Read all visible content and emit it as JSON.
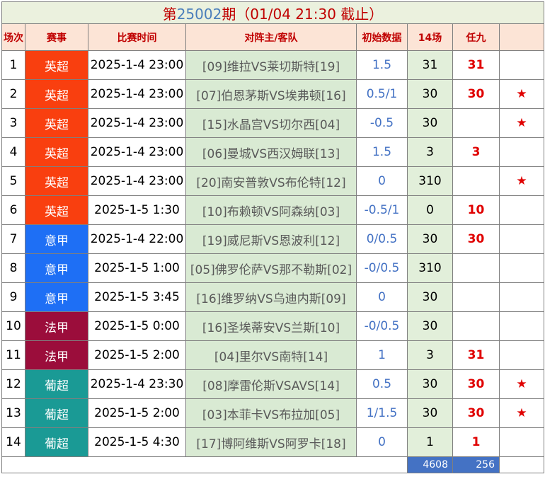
{
  "title": {
    "prefix": "第",
    "issue": "25002",
    "suffix": "期（01/04 21:30 截止）"
  },
  "headers": [
    "场次",
    "赛事",
    "比赛时间",
    "对阵主/客队",
    "初始数据",
    "14场",
    "任九",
    ""
  ],
  "league_colors": {
    "英超": "#f93f0f",
    "意甲": "#1e6ff5",
    "法甲": "#9b0d3b",
    "葡超": "#1a9a95"
  },
  "rows": [
    {
      "no": "1",
      "league": "英超",
      "time": "2025-1-4 23:00",
      "match": "[09]维拉VS莱切斯特[19]",
      "init": "1.5",
      "p14": "31",
      "r9": "31",
      "star": ""
    },
    {
      "no": "2",
      "league": "英超",
      "time": "2025-1-4 23:00",
      "match": "[07]伯恩茅斯VS埃弗顿[16]",
      "init": "0.5/1",
      "p14": "30",
      "r9": "30",
      "star": "★"
    },
    {
      "no": "3",
      "league": "英超",
      "time": "2025-1-4 23:00",
      "match": "[15]水晶宫VS切尔西[04]",
      "init": "-0.5",
      "p14": "30",
      "r9": "",
      "star": "★"
    },
    {
      "no": "4",
      "league": "英超",
      "time": "2025-1-4 23:00",
      "match": "[06]曼城VS西汉姆联[13]",
      "init": "1.5",
      "p14": "3",
      "r9": "3",
      "star": ""
    },
    {
      "no": "5",
      "league": "英超",
      "time": "2025-1-4 23:00",
      "match": "[20]南安普敦VS布伦特[12]",
      "init": "0",
      "p14": "310",
      "r9": "",
      "star": "★"
    },
    {
      "no": "6",
      "league": "英超",
      "time": "2025-1-5 1:30",
      "match": "[10]布赖顿VS阿森纳[03]",
      "init": "-0.5/1",
      "p14": "0",
      "r9": "10",
      "star": ""
    },
    {
      "no": "7",
      "league": "意甲",
      "time": "2025-1-4 22:00",
      "match": "[19]威尼斯VS恩波利[12]",
      "init": "0/0.5",
      "p14": "30",
      "r9": "30",
      "star": ""
    },
    {
      "no": "8",
      "league": "意甲",
      "time": "2025-1-5 1:00",
      "match": "[05]佛罗伦萨VS那不勒斯[02]",
      "init": "-0/0.5",
      "p14": "310",
      "r9": "",
      "star": ""
    },
    {
      "no": "9",
      "league": "意甲",
      "time": "2025-1-5 3:45",
      "match": "[16]维罗纳VS乌迪内斯[09]",
      "init": "0",
      "p14": "30",
      "r9": "",
      "star": ""
    },
    {
      "no": "10",
      "league": "法甲",
      "time": "2025-1-5 0:00",
      "match": "[16]圣埃蒂安VS兰斯[10]",
      "init": "-0/0.5",
      "p14": "30",
      "r9": "",
      "star": ""
    },
    {
      "no": "11",
      "league": "法甲",
      "time": "2025-1-5 2:00",
      "match": "[04]里尔VS南特[14]",
      "init": "1",
      "p14": "3",
      "r9": "31",
      "star": ""
    },
    {
      "no": "12",
      "league": "葡超",
      "time": "2025-1-4 23:30",
      "match": "[08]摩雷伦斯VSAVS[14]",
      "init": "0.5",
      "p14": "30",
      "r9": "30",
      "star": "★"
    },
    {
      "no": "13",
      "league": "葡超",
      "time": "2025-1-5 2:00",
      "match": "[03]本菲卡VS布拉加[05]",
      "init": "1/1.5",
      "p14": "30",
      "r9": "30",
      "star": "★"
    },
    {
      "no": "14",
      "league": "葡超",
      "time": "2025-1-5 4:30",
      "match": "[17]博阿维斯VS阿罗卡[18]",
      "init": "0",
      "p14": "1",
      "r9": "1",
      "star": ""
    }
  ],
  "footer": {
    "total14": "4608",
    "totalR9": "256"
  }
}
